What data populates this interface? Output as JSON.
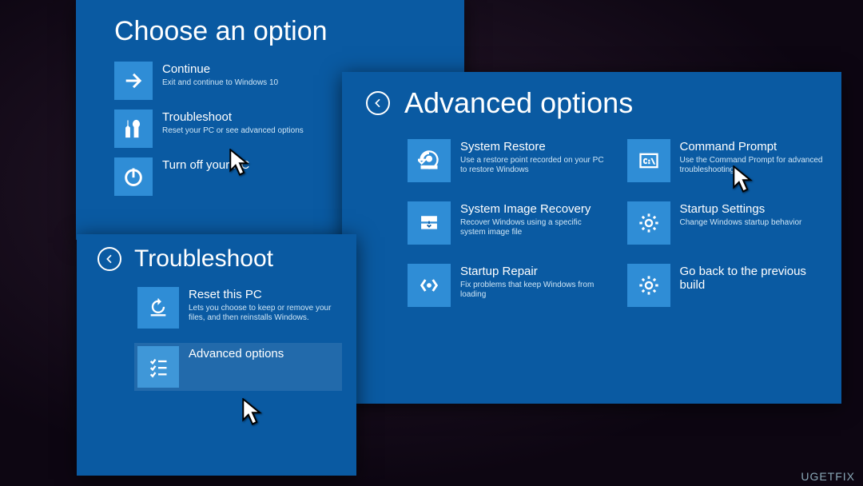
{
  "panel1": {
    "title": "Choose an option",
    "tiles": [
      {
        "title": "Continue",
        "desc": "Exit and continue to Windows 10"
      },
      {
        "title": "Troubleshoot",
        "desc": "Reset your PC or see advanced options"
      },
      {
        "title": "Turn off your PC",
        "desc": ""
      }
    ]
  },
  "panel2": {
    "title": "Troubleshoot",
    "tiles": [
      {
        "title": "Reset this PC",
        "desc": "Lets you choose to keep or remove your files, and then reinstalls Windows."
      },
      {
        "title": "Advanced options",
        "desc": ""
      }
    ]
  },
  "panel3": {
    "title": "Advanced options",
    "tiles": [
      {
        "title": "System Restore",
        "desc": "Use a restore point recorded on your PC to restore Windows"
      },
      {
        "title": "Command Prompt",
        "desc": "Use the Command Prompt for advanced troubleshooting"
      },
      {
        "title": "System Image Recovery",
        "desc": "Recover Windows using a specific system image file"
      },
      {
        "title": "Startup Settings",
        "desc": "Change Windows startup behavior"
      },
      {
        "title": "Startup Repair",
        "desc": "Fix problems that keep Windows from loading"
      },
      {
        "title": "Go back to the previous build",
        "desc": ""
      }
    ]
  },
  "watermark": "UGETFIX"
}
